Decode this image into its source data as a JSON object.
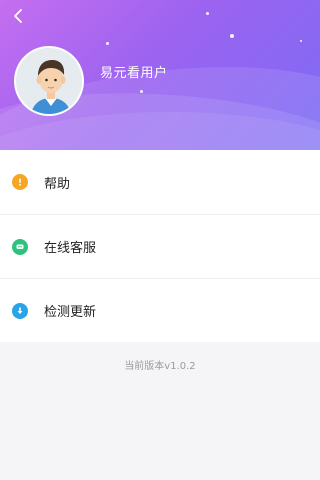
{
  "header": {
    "username": "易元看用户"
  },
  "menu": {
    "items": [
      {
        "label": "帮助",
        "icon": "help-icon",
        "color": "#f5a623"
      },
      {
        "label": "在线客服",
        "icon": "chat-icon",
        "color": "#2ec27e"
      },
      {
        "label": "检测更新",
        "icon": "update-icon",
        "color": "#2ba3e8"
      }
    ]
  },
  "footer": {
    "version": "当前版本v1.0.2"
  },
  "colors": {
    "header_gradient_start": "#c56ef0",
    "header_gradient_end": "#7c6cf5",
    "background": "#f5f5f7"
  }
}
